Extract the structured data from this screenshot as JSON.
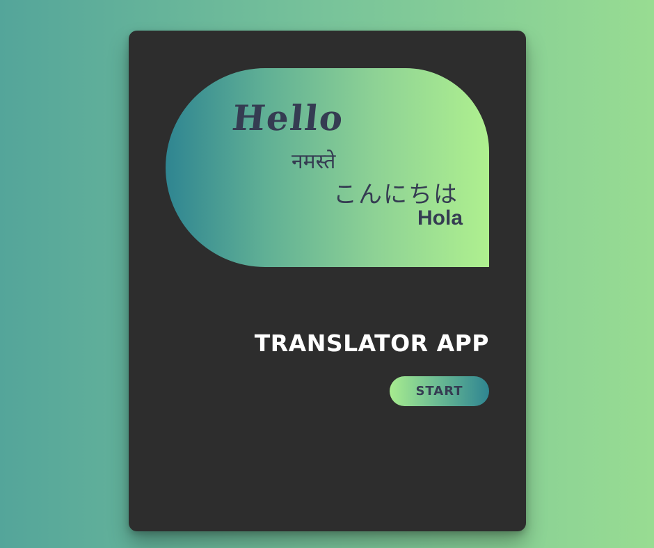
{
  "greetings": {
    "english": "Hello",
    "hindi": "नमस्ते",
    "japanese": "こんにちは",
    "spanish": "Hola"
  },
  "app": {
    "title": "TRANSLATOR APP",
    "start_label": "START"
  },
  "colors": {
    "background_start": "#54a59a",
    "background_end": "#98dc92",
    "card": "#2d2d2d",
    "bubble_start": "#2f8591",
    "bubble_end": "#aff08f",
    "greeting_text": "#353c52",
    "title_text": "#ffffff"
  }
}
